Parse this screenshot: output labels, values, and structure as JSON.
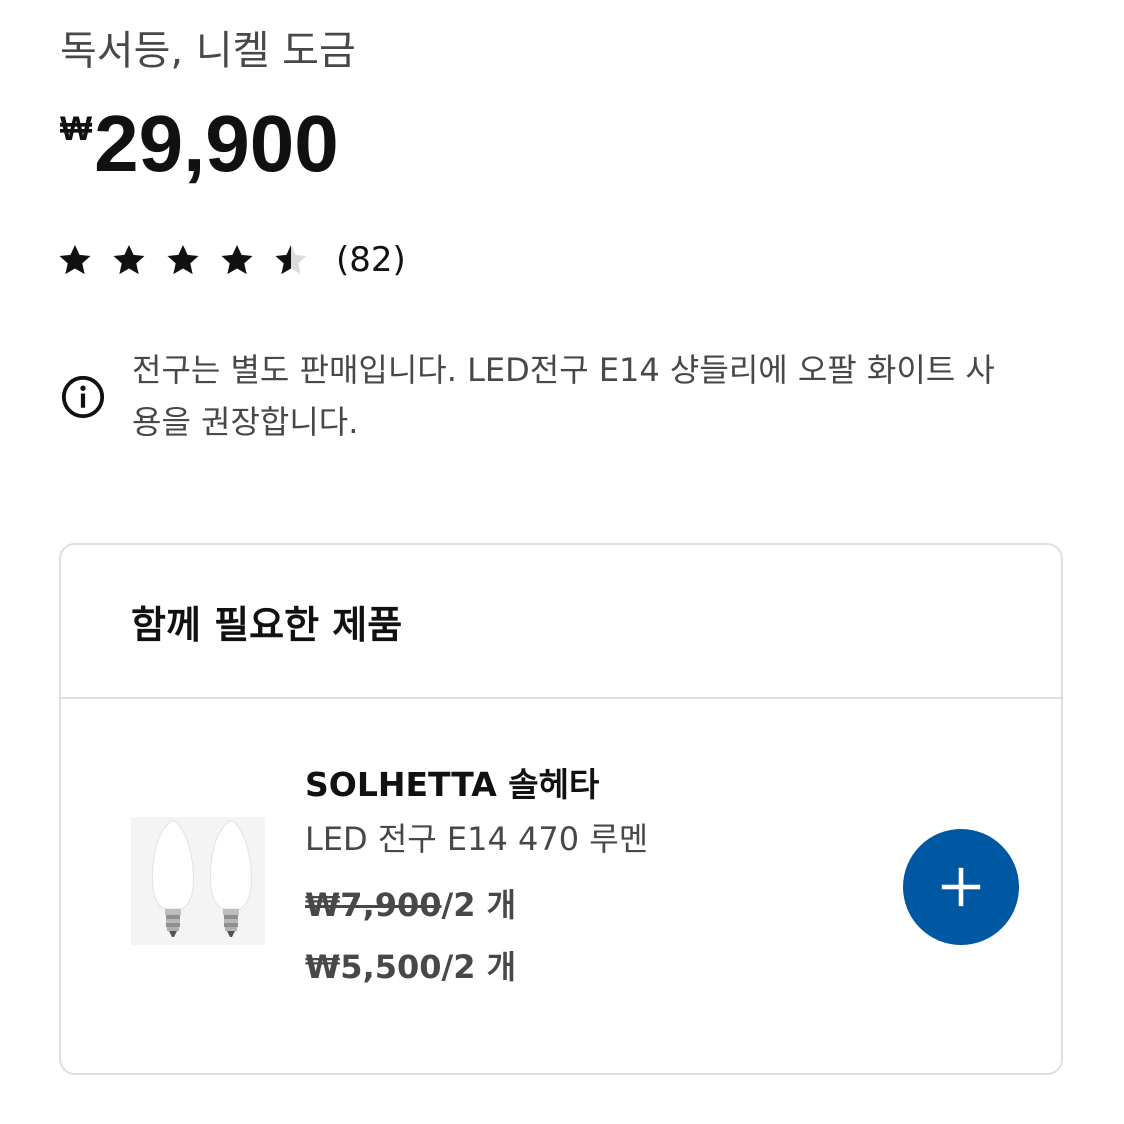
{
  "product": {
    "subtitle": "독서등, 니켈 도금",
    "price_currency": "₩",
    "price_amount": "29,900",
    "rating": {
      "stars": 4.5,
      "max_stars": 5,
      "count_text": "(82)"
    },
    "notice": {
      "icon": "info-icon",
      "text": "전구는 별도 판매입니다. LED전구 E14 샹들리에 오팔 화이트 사용을 권장합니다."
    }
  },
  "related": {
    "title": "함께 필요한 제품",
    "items": [
      {
        "name": "SOLHETTA 솔헤타",
        "description": "LED 전구 E14 470 루멘",
        "old_price": "₩7,900",
        "old_price_suffix": "/2 개",
        "new_price": "₩5,500/2 개",
        "image": "two-led-candle-bulbs",
        "add_icon": "plus-icon"
      }
    ]
  },
  "colors": {
    "accent": "#0058a3",
    "text_primary": "#111111",
    "text_secondary": "#484848",
    "border": "#dfdfdf"
  }
}
